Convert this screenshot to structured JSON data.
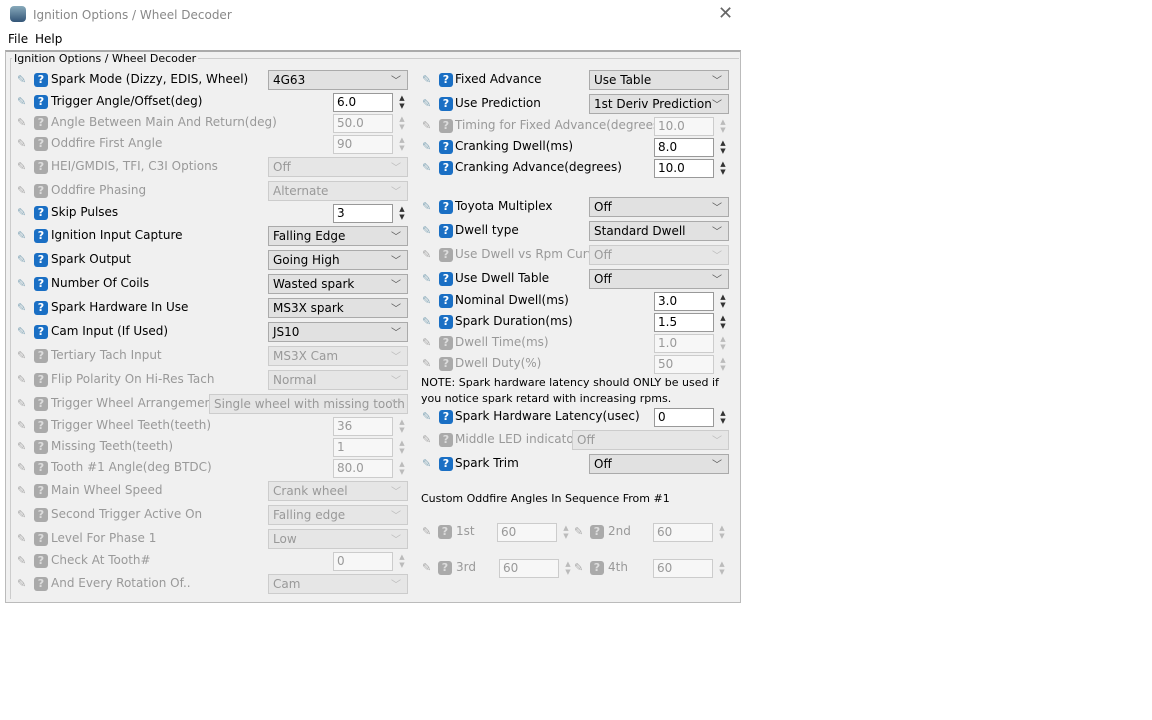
{
  "window": {
    "title": "Ignition Options / Wheel Decoder",
    "close_icon": "close-icon",
    "menu": [
      "File",
      "Help"
    ],
    "group_label": "Ignition Options / Wheel Decoder"
  },
  "left": [
    {
      "label": "Spark Mode (Dizzy, EDIS, Wheel)",
      "type": "select",
      "value": "4G63",
      "enabled": true
    },
    {
      "label": "Trigger Angle/Offset(deg)",
      "type": "spin",
      "value": "6.0",
      "enabled": true
    },
    {
      "label": "Angle Between Main And Return(deg)",
      "type": "spin",
      "value": "50.0",
      "enabled": false
    },
    {
      "label": "Oddfire First Angle",
      "type": "spin",
      "value": "90",
      "enabled": false
    },
    {
      "label": "HEI/GMDIS, TFI, C3I Options",
      "type": "select",
      "value": "Off",
      "enabled": false
    },
    {
      "label": "Oddfire Phasing",
      "type": "select",
      "value": "Alternate",
      "enabled": false
    },
    {
      "label": "Skip Pulses",
      "type": "spin",
      "value": "3",
      "enabled": true
    },
    {
      "label": "Ignition Input Capture",
      "type": "select",
      "value": "Falling Edge",
      "enabled": true
    },
    {
      "label": "Spark Output",
      "type": "select",
      "value": "Going High",
      "enabled": true
    },
    {
      "label": "Number Of Coils",
      "type": "select",
      "value": "Wasted spark",
      "enabled": true
    },
    {
      "label": "Spark Hardware In Use",
      "type": "select",
      "value": "MS3X spark",
      "enabled": true
    },
    {
      "label": "Cam Input (If Used)",
      "type": "select",
      "value": "JS10",
      "enabled": true
    },
    {
      "label": "Tertiary Tach Input",
      "type": "select",
      "value": "MS3X Cam",
      "enabled": false
    },
    {
      "label": "Flip Polarity On Hi-Res Tach",
      "type": "select",
      "value": "Normal",
      "enabled": false
    },
    {
      "label": "Trigger Wheel Arrangement",
      "type": "select",
      "value": "Single wheel with missing tooth",
      "enabled": false
    },
    {
      "label": "Trigger Wheel Teeth(teeth)",
      "type": "spin",
      "value": "36",
      "enabled": false
    },
    {
      "label": "Missing Teeth(teeth)",
      "type": "spin",
      "value": "1",
      "enabled": false
    },
    {
      "label": "Tooth #1 Angle(deg BTDC)",
      "type": "spin",
      "value": "80.0",
      "enabled": false
    },
    {
      "label": "Main Wheel Speed",
      "type": "select",
      "value": "Crank wheel",
      "enabled": false
    },
    {
      "label": "Second Trigger Active On",
      "type": "select",
      "value": "Falling edge",
      "enabled": false
    },
    {
      "label": "Level For Phase 1",
      "type": "select",
      "value": "Low",
      "enabled": false
    },
    {
      "label": "Check At Tooth#",
      "type": "spin",
      "value": "0",
      "enabled": false
    },
    {
      "label": "And Every Rotation Of..",
      "type": "select",
      "value": "Cam",
      "enabled": false
    }
  ],
  "right": [
    {
      "label": "Fixed Advance",
      "type": "select",
      "value": "Use Table",
      "enabled": true
    },
    {
      "label": "Use Prediction",
      "type": "select",
      "value": "1st Deriv Prediction",
      "enabled": true
    },
    {
      "label": "Timing for Fixed Advance(degrees)",
      "type": "spin",
      "value": "10.0",
      "enabled": false
    },
    {
      "label": "Cranking Dwell(ms)",
      "type": "spin",
      "value": "8.0",
      "enabled": true
    },
    {
      "label": "Cranking Advance(degrees)",
      "type": "spin",
      "value": "10.0",
      "enabled": true
    },
    {
      "label": "Toyota Multiplex",
      "type": "select",
      "value": "Off",
      "enabled": true
    },
    {
      "label": "Dwell type",
      "type": "select",
      "value": "Standard Dwell",
      "enabled": true
    },
    {
      "label": "Use Dwell vs Rpm Curve",
      "type": "select",
      "value": "Off",
      "enabled": false
    },
    {
      "label": "Use Dwell Table",
      "type": "select",
      "value": "Off",
      "enabled": true
    },
    {
      "label": "Nominal Dwell(ms)",
      "type": "spin",
      "value": "3.0",
      "enabled": true
    },
    {
      "label": "Spark Duration(ms)",
      "type": "spin",
      "value": "1.5",
      "enabled": true
    },
    {
      "label": "Dwell Time(ms)",
      "type": "spin",
      "value": "1.0",
      "enabled": false
    },
    {
      "label": "Dwell Duty(%)",
      "type": "spin",
      "value": "50",
      "enabled": false
    },
    {
      "label": "Spark Hardware Latency(usec)",
      "type": "spin",
      "value": "0",
      "enabled": true
    },
    {
      "label": "Middle LED indicator",
      "type": "select",
      "value": "Off",
      "enabled": false
    },
    {
      "label": "Spark Trim",
      "type": "select",
      "value": "Off",
      "enabled": true
    }
  ],
  "note": [
    "NOTE: Spark hardware latency should ONLY be used if",
    "you notice spark retard with increasing rpms."
  ],
  "oddfire": {
    "heading": "Custom Oddfire Angles In Sequence From #1",
    "items": [
      {
        "label": "1st",
        "value": "60",
        "enabled": false
      },
      {
        "label": "2nd",
        "value": "60",
        "enabled": false
      },
      {
        "label": "3rd",
        "value": "60",
        "enabled": false
      },
      {
        "label": "4th",
        "value": "60",
        "enabled": false
      }
    ]
  }
}
